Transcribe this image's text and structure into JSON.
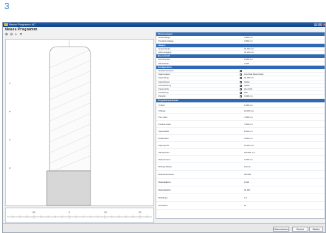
{
  "figure_number": "3",
  "window": {
    "title": "Neuer Programm AC"
  },
  "header": {
    "title": "Neues Programm"
  },
  "toolbar": {
    "icons": [
      "zoom-in-icon",
      "zoom-out-icon",
      "fit-icon",
      "settings-icon"
    ]
  },
  "ruler": {
    "ticks": [
      "-20",
      "0",
      "10",
      "20"
    ]
  },
  "left_marks": [
    "A",
    "B",
    "C",
    "D"
  ],
  "properties": {
    "sections": [
      {
        "title": "Abmessungen",
        "rows": [
          {
            "key": "Gesamtlänge",
            "value": "1.800 mm"
          },
          {
            "key": "Produktionslänge",
            "value": "1.800 mm"
          }
        ]
      },
      {
        "title": "Längen",
        "rows": [
          {
            "key": "Gesamtbreite",
            "value": "40.000 mm"
          },
          {
            "key": "Höhe Ausgang",
            "value": "40.000 mm"
          }
        ]
      },
      {
        "title": "Querschnitt",
        "rows": [
          {
            "key": "Durchmesser",
            "value": "2.000 mm"
          },
          {
            "key": "Wandstärke",
            "value": "2.000"
          }
        ]
      },
      {
        "title": "Konfiguration",
        "rows": [
          {
            "key": "Gerade Konturen",
            "value": "",
            "checkbox": true
          },
          {
            "key": "Spannsystem",
            "value": "Dornhülle Spannhülse",
            "checkbox": true
          },
          {
            "key": "Spannlänge",
            "value": "30.000 mm",
            "checkbox": true
          },
          {
            "key": "Spannkörper",
            "value": "Spalte",
            "checkbox": true
          },
          {
            "key": "Schutzführung",
            "value": "Spalte",
            "checkbox": true
          },
          {
            "key": "Kantenhöhe",
            "value": "über R10",
            "checkbox": true
          },
          {
            "key": "Ausführung",
            "value": "Hart",
            "checkbox": true
          },
          {
            "key": "Zubehör",
            "value": "0.000 mm",
            "checkbox": true
          }
        ]
      },
      {
        "title": "Programmparameter",
        "rows": [
          {
            "key": "X Start",
            "value": "1.000 mm"
          },
          {
            "key": "X Breite",
            "value": "11.000 mm"
          },
          {
            "key": "Pos. oben",
            "value": "7.000 mm"
          },
          {
            "key": "Position unten",
            "value": "7.000 mm"
          },
          {
            "key": "Spannkräfte",
            "value": "8.000 mm"
          },
          {
            "key": "Endposition",
            "value": "0.000 mm"
          },
          {
            "key": "Spannpunkt",
            "value": "11.000 mm"
          },
          {
            "key": "Startposition",
            "value": "100.000 mm"
          },
          {
            "key": "Referenzwert",
            "value": "1.000 mm"
          },
          {
            "key": "Rohrtyp Klasse",
            "value": "Normal"
          },
          {
            "key": "Rohrdurchmesser",
            "value": "100.000"
          },
          {
            "key": "Materialdichte",
            "value": "0.000"
          },
          {
            "key": "Materialstärke",
            "value": "40.000"
          },
          {
            "key": "Rohrlänge",
            "value": "1.0"
          },
          {
            "key": "Grundwert",
            "value": "10"
          }
        ]
      }
    ]
  },
  "buttons": {
    "apply": "Übernehmen",
    "back": "Zurück",
    "next": "Weiter"
  }
}
